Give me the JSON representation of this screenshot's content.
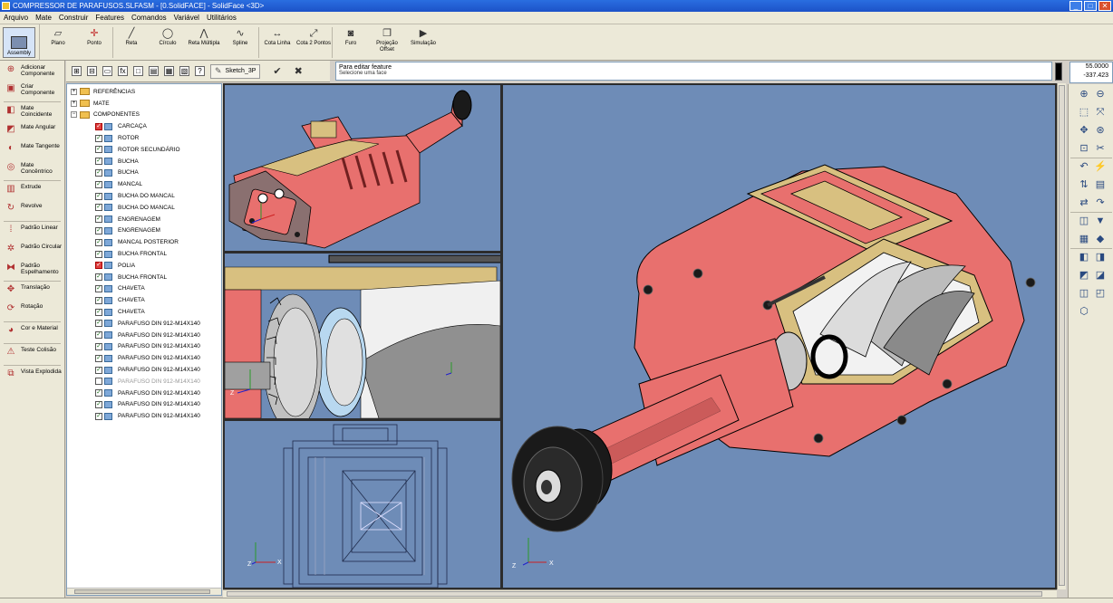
{
  "window": {
    "title": "COMPRESSOR DE PARAFUSOS.SLFASM - [0.SolidFACE] - SolidFace <3D>",
    "min_glyph": "_",
    "max_glyph": "□",
    "close_glyph": "✕"
  },
  "menu": [
    "Arquivo",
    "Mate",
    "Construir",
    "Features",
    "Comandos",
    "Variável",
    "Utilitários"
  ],
  "toolbar": {
    "assembly_label": "Assembly",
    "buttons": [
      {
        "label": "Plano",
        "icon": "plane-icon",
        "glyph": "▱"
      },
      {
        "label": "Ponto",
        "icon": "point-icon",
        "glyph": "✛"
      },
      {
        "label": "Reta",
        "icon": "line-icon",
        "glyph": "╱"
      },
      {
        "label": "Círculo",
        "icon": "circle-icon",
        "glyph": "◯"
      },
      {
        "label": "Reta Múltipla",
        "icon": "polyline-icon",
        "glyph": "⋀"
      },
      {
        "label": "Spline",
        "icon": "spline-icon",
        "glyph": "∿"
      },
      {
        "label": "Cota Linha",
        "icon": "dimension-line-icon",
        "glyph": "↔"
      },
      {
        "label": "Cota 2 Pontos",
        "icon": "dimension-points-icon",
        "glyph": "⤢"
      },
      {
        "label": "Furo",
        "icon": "hole-icon",
        "glyph": "◙"
      },
      {
        "label": "Projeção Offset",
        "icon": "projection-offset-icon",
        "glyph": "❐"
      },
      {
        "label": "Simulação",
        "icon": "simulation-icon",
        "glyph": "▶"
      }
    ]
  },
  "palette": [
    {
      "label": "Adicionar Componente",
      "icon": "add-component-icon",
      "glyph": "⊕"
    },
    {
      "label": "Criar Componente",
      "icon": "create-component-icon",
      "glyph": "▣"
    },
    {
      "label": "Mate Coincidente",
      "icon": "mate-coincident-icon",
      "glyph": "◧"
    },
    {
      "label": "Mate Angular",
      "icon": "mate-angular-icon",
      "glyph": "◩"
    },
    {
      "label": "Mate Tangente",
      "icon": "mate-tangent-icon",
      "glyph": "◐"
    },
    {
      "label": "Mate Concêntrico",
      "icon": "mate-concentric-icon",
      "glyph": "◎"
    },
    {
      "label": "Extrude",
      "icon": "extrude-icon",
      "glyph": "▥"
    },
    {
      "label": "Revolve",
      "icon": "revolve-icon",
      "glyph": "↻"
    },
    {
      "label": "Padrão Linear",
      "icon": "pattern-linear-icon",
      "glyph": "⁞"
    },
    {
      "label": "Padrão Circular",
      "icon": "pattern-circular-icon",
      "glyph": "✲"
    },
    {
      "label": "Padrão Espelhamento",
      "icon": "pattern-mirror-icon",
      "glyph": "⧓"
    },
    {
      "label": "Translação",
      "icon": "translate-icon",
      "glyph": "✥"
    },
    {
      "label": "Rotação",
      "icon": "rotate-icon",
      "glyph": "⟳"
    },
    {
      "label": "Cor e Material",
      "icon": "color-material-icon",
      "glyph": "◕"
    },
    {
      "label": "Teste Colisão",
      "icon": "collision-test-icon",
      "glyph": "⚠"
    },
    {
      "label": "Vista Explodida",
      "icon": "exploded-view-icon",
      "glyph": "⧉"
    }
  ],
  "sketch": {
    "name": "Sketch_3P",
    "pen_glyph": "✎",
    "confirm_glyph": "✔",
    "cancel_glyph": "✖"
  },
  "tree_toolbar_glyphs": [
    "⊞",
    "⊟",
    "▭",
    "fx",
    "□",
    "▤",
    "▦",
    "▧",
    "?"
  ],
  "message": {
    "line1": "Para editar feature",
    "line2": "Selecione uma face"
  },
  "coords": {
    "x": "55.0000",
    "y": "-337.423"
  },
  "tree": {
    "folders": [
      {
        "label": "REFERÊNCIAS",
        "expander": "+"
      },
      {
        "label": "MATE",
        "expander": "+"
      },
      {
        "label": "COMPONENTES",
        "expander": "−"
      }
    ],
    "components": [
      {
        "label": "CARCAÇA",
        "state": "err",
        "mark": "✓"
      },
      {
        "label": "ROTOR",
        "state": "ok",
        "mark": "✓"
      },
      {
        "label": "ROTOR SECUNDÁRIO",
        "state": "ok",
        "mark": "✓"
      },
      {
        "label": "BUCHA",
        "state": "ok",
        "mark": "✓"
      },
      {
        "label": "BUCHA",
        "state": "ok",
        "mark": "✓"
      },
      {
        "label": "MANCAL",
        "state": "ok",
        "mark": "✓"
      },
      {
        "label": "BUCHA DO MANCAL",
        "state": "ok",
        "mark": "✓"
      },
      {
        "label": "BUCHA DO MANCAL",
        "state": "ok",
        "mark": "✓"
      },
      {
        "label": "ENGRENAGEM",
        "state": "ok",
        "mark": "✓"
      },
      {
        "label": "ENGRENAGEM",
        "state": "ok",
        "mark": "✓"
      },
      {
        "label": "MANCAL POSTERIOR",
        "state": "ok",
        "mark": "✓"
      },
      {
        "label": "BUCHA FRONTAL",
        "state": "ok",
        "mark": "✓"
      },
      {
        "label": "POLIA",
        "state": "err",
        "mark": "✓"
      },
      {
        "label": "BUCHA FRONTAL",
        "state": "ok",
        "mark": "✓"
      },
      {
        "label": "CHAVETA",
        "state": "ok",
        "mark": "✓"
      },
      {
        "label": "CHAVETA",
        "state": "ok",
        "mark": "✓"
      },
      {
        "label": "CHAVETA",
        "state": "ok",
        "mark": "✓"
      },
      {
        "label": "PARAFUSO DIN 912-M14X140",
        "state": "ok",
        "mark": "✓"
      },
      {
        "label": "PARAFUSO DIN 912-M14X140",
        "state": "ok",
        "mark": "✓"
      },
      {
        "label": "PARAFUSO DIN 912-M14X140",
        "state": "ok",
        "mark": "✓"
      },
      {
        "label": "PARAFUSO DIN 912-M14X140",
        "state": "ok",
        "mark": "✓"
      },
      {
        "label": "PARAFUSO DIN 912-M14X140",
        "state": "ok",
        "mark": "✓"
      },
      {
        "label": "PARAFUSO DIN 912-M14X140",
        "state": "ghost",
        "mark": ""
      },
      {
        "label": "PARAFUSO DIN 912-M14X140",
        "state": "ok",
        "mark": "✓"
      },
      {
        "label": "PARAFUSO DIN 912-M14X140",
        "state": "ok",
        "mark": "✓"
      },
      {
        "label": "PARAFUSO DIN 912-M14X140",
        "state": "ok",
        "mark": "✓"
      }
    ]
  },
  "viewports": {
    "axis_x": "X",
    "axis_z": "Z",
    "colors": {
      "background": "#6e8cb7",
      "body": "#e8706e",
      "body_dark": "#b04848",
      "cut_face": "#d8c080",
      "rotor": "#c8c8c8",
      "pulley": "#1a1a1a"
    }
  },
  "right_tools": [
    {
      "name": "zoom-in-icon",
      "glyph": "⊕"
    },
    {
      "name": "zoom-out-icon",
      "glyph": "⊖"
    },
    {
      "name": "zoom-window-icon",
      "glyph": "⬚"
    },
    {
      "name": "zoom-fit-icon",
      "glyph": "⤧"
    },
    {
      "name": "pan-icon",
      "glyph": "✥"
    },
    {
      "name": "zoom-dynamic-icon",
      "glyph": "⊛"
    },
    {
      "name": "zoom-area-icon",
      "glyph": "⊡"
    },
    {
      "name": "view-tools-icon",
      "glyph": "✂"
    },
    {
      "name": "undo-icon",
      "glyph": "↶"
    },
    {
      "name": "lightning-icon",
      "glyph": "⚡"
    },
    {
      "name": "rotate-x-icon",
      "glyph": "⇅"
    },
    {
      "name": "section-icon",
      "glyph": "▤"
    },
    {
      "name": "rotate-y-icon",
      "glyph": "⇄"
    },
    {
      "name": "redo-icon",
      "glyph": "↷"
    },
    {
      "name": "view-cube-icon",
      "glyph": "◫"
    },
    {
      "name": "filter-icon",
      "glyph": "▼"
    },
    {
      "name": "display-mode-icon",
      "glyph": "▦"
    },
    {
      "name": "eraser-icon",
      "glyph": "◆"
    },
    {
      "name": "iso-view-icon",
      "glyph": "◧"
    },
    {
      "name": "front-view-icon",
      "glyph": "◨"
    },
    {
      "name": "top-view-icon",
      "glyph": "◩"
    },
    {
      "name": "side-view-icon",
      "glyph": "◪"
    },
    {
      "name": "back-view-icon",
      "glyph": "◫"
    },
    {
      "name": "bottom-view-icon",
      "glyph": "◰"
    },
    {
      "name": "cube-3d-icon",
      "glyph": "⬡"
    }
  ]
}
